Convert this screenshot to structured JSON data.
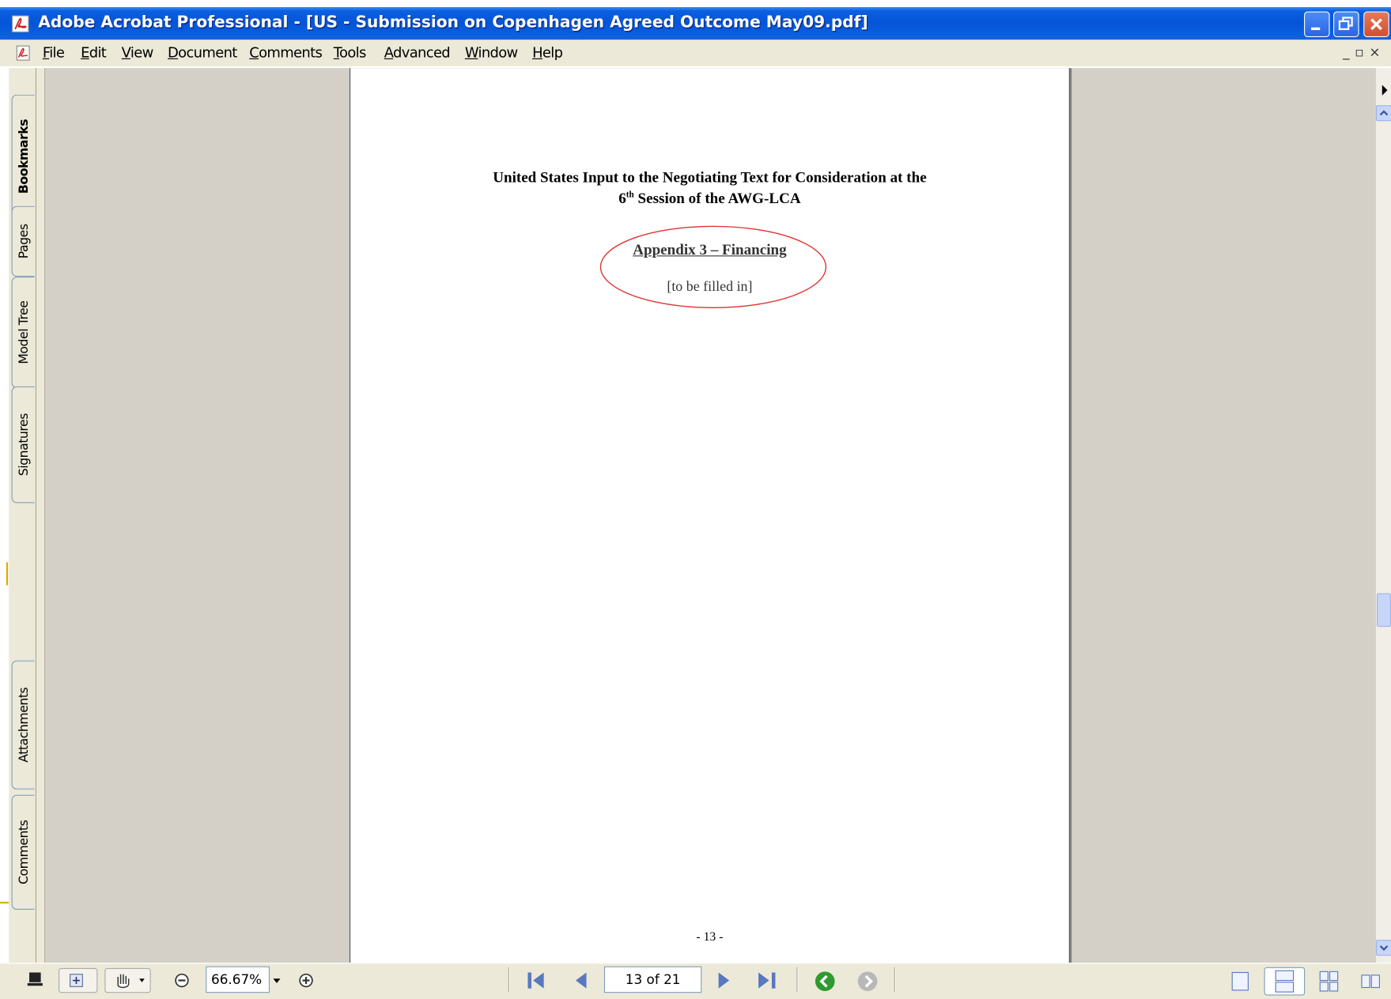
{
  "window": {
    "title": "Adobe Acrobat Professional - [US - Submission on Copenhagen Agreed Outcome May09.pdf]"
  },
  "menu": {
    "items": [
      "File",
      "Edit",
      "View",
      "Document",
      "Comments",
      "Tools",
      "Advanced",
      "Window",
      "Help"
    ]
  },
  "nav_tabs": [
    "Bookmarks",
    "Pages",
    "Model Tree",
    "Signatures",
    "Attachments",
    "Comments"
  ],
  "document": {
    "heading_line1": "United States Input to the Negotiating Text for Consideration at the",
    "heading_line2_num": "6",
    "heading_line2_sup": "th",
    "heading_line2_rest": " Session of the AWG-LCA",
    "appendix_title": "Appendix 3 – Financing",
    "placeholder_note": "[to be filled in]",
    "page_footer": "- 13 -",
    "annotation_color": "#e03030"
  },
  "statusbar": {
    "zoom": "66.67%",
    "page_indicator": "13 of 21"
  },
  "colors": {
    "titlebar": "#0554d8",
    "chrome": "#ece9d8",
    "doc_background": "#d4d0c8"
  }
}
